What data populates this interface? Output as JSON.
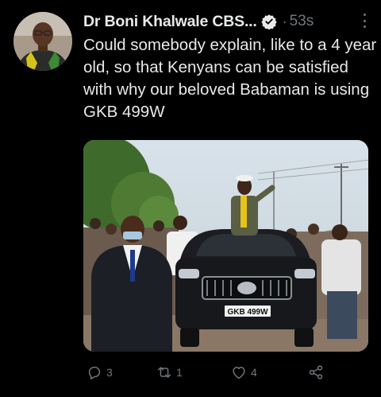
{
  "tweet": {
    "author_name": "Dr Boni Khalwale CBS...",
    "separator": "·",
    "time": "53s",
    "text": "Could somebody explain, like to a 4 year old, so that Kenyans can be satisfied with why our beloved Babaman is using GKB 499W",
    "plate_text": "GKB 499W"
  },
  "actions": {
    "reply_icon": "reply-icon",
    "reply_count": "3",
    "retweet_icon": "retweet-icon",
    "retweet_count": "1",
    "like_icon": "heart-icon",
    "like_count": "4",
    "share_icon": "share-icon"
  },
  "colors": {
    "background": "#000000",
    "text": "#e7e9ea",
    "muted": "#71767b",
    "verified": "#e7e9ea"
  }
}
